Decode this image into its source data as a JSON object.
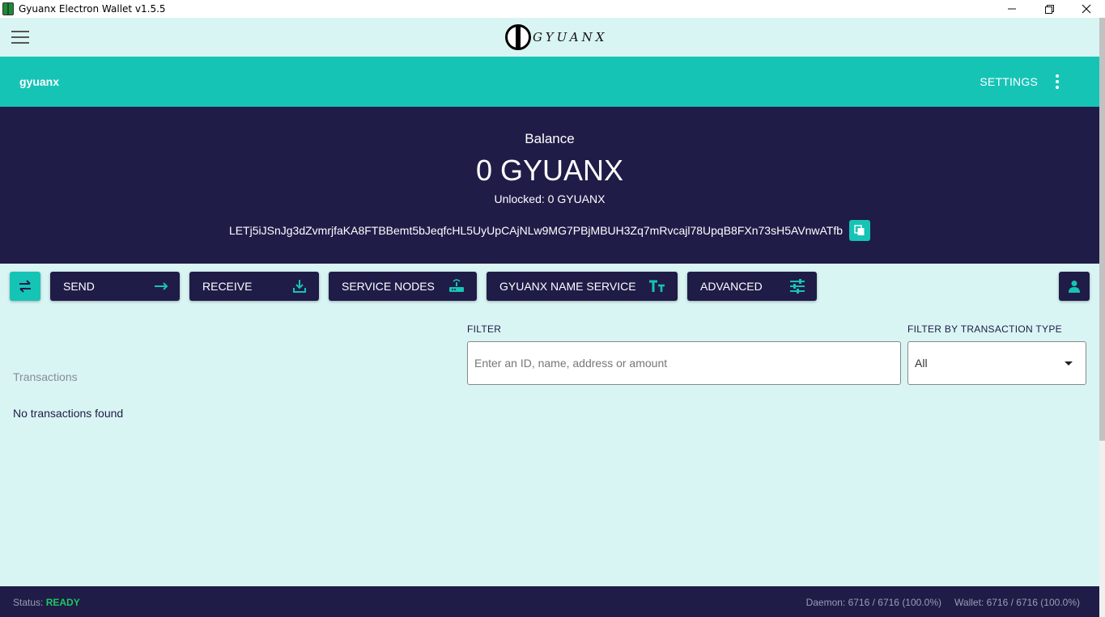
{
  "window": {
    "title": "Gyuanx Electron Wallet v1.5.5",
    "controls": [
      "minimize-icon",
      "restore-icon",
      "close-icon"
    ]
  },
  "header": {
    "logo_text": "GYUANX"
  },
  "wallet_bar": {
    "wallet_name": "gyuanx",
    "settings_label": "SETTINGS"
  },
  "balance": {
    "label": "Balance",
    "value": "0 GYUANX",
    "unlocked": "Unlocked: 0 GYUANX",
    "address": "LETj5iJSnJg3dZvmrjfaKA8FTBBemt5bJeqfcHL5UyUpCAjNLw9MG7PBjMBUH3Zq7mRvcajl78UpqB8FXn73sH5AVnwATfb"
  },
  "toolbar": {
    "send": "SEND",
    "receive": "RECEIVE",
    "service_nodes": "SERVICE NODES",
    "name_service": "GYUANX NAME SERVICE",
    "advanced": "ADVANCED"
  },
  "filters": {
    "filter_label": "FILTER",
    "filter_placeholder": "Enter an ID, name, address or amount",
    "type_label": "FILTER BY TRANSACTION TYPE",
    "type_selected": "All"
  },
  "transactions": {
    "heading": "Transactions",
    "empty_text": "No transactions found"
  },
  "status": {
    "label": "Status:",
    "value": "READY",
    "daemon": "Daemon: 6716 / 6716 (100.0%)",
    "wallet": "Wallet: 6716 / 6716 (100.0%)"
  },
  "colors": {
    "accent": "#16c4b6",
    "navy": "#1f1c48",
    "background": "#d9f5f3",
    "ready": "#1ec85e"
  }
}
